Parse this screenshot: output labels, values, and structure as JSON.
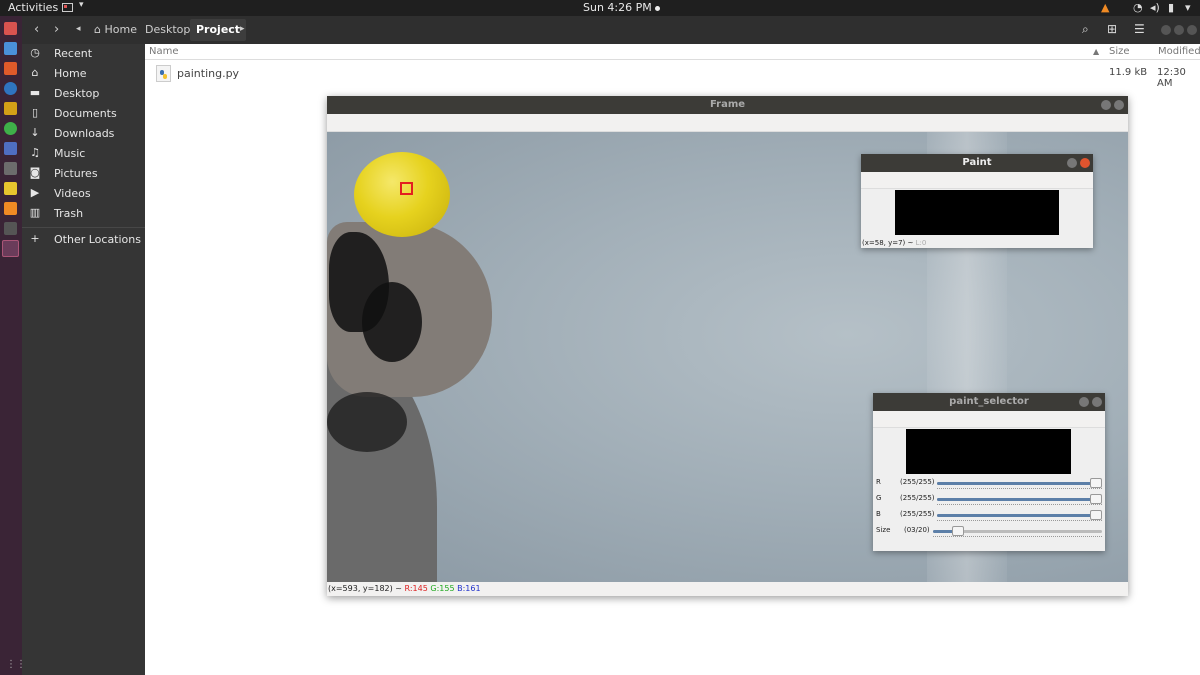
{
  "topbar": {
    "activities": "Activities",
    "clock": "Sun  4:26 PM"
  },
  "toolbar": {
    "crumbs": [
      "Home",
      "Desktop",
      "Project"
    ]
  },
  "sidebar": {
    "items": [
      {
        "label": "Recent",
        "icon": "clock-icon"
      },
      {
        "label": "Home",
        "icon": "home-icon"
      },
      {
        "label": "Desktop",
        "icon": "folder-icon"
      },
      {
        "label": "Documents",
        "icon": "document-icon"
      },
      {
        "label": "Downloads",
        "icon": "download-icon"
      },
      {
        "label": "Music",
        "icon": "music-icon"
      },
      {
        "label": "Pictures",
        "icon": "camera-icon"
      },
      {
        "label": "Videos",
        "icon": "video-icon"
      },
      {
        "label": "Trash",
        "icon": "trash-icon"
      },
      {
        "label": "Other Locations",
        "icon": "plus-icon"
      }
    ]
  },
  "filelist": {
    "columns": {
      "name": "Name",
      "size": "Size",
      "modified": "Modified"
    },
    "files": [
      {
        "name": "painting.py",
        "size": "11.9 kB",
        "modified": "12:30 AM"
      }
    ]
  },
  "frame": {
    "title": "Frame",
    "status_coords": "(x=593, y=182) ~",
    "status_r": "R:145",
    "status_g": "G:155",
    "status_b": "B:161"
  },
  "paint": {
    "title": "Paint",
    "status_coords": "(x=58, y=7) ~",
    "status_l": "L:0"
  },
  "selector": {
    "title": "paint_selector",
    "sliders": [
      {
        "name": "R",
        "value_text": "(255/255)",
        "fraction": 1.0
      },
      {
        "name": "G",
        "value_text": "(255/255)",
        "fraction": 1.0
      },
      {
        "name": "B",
        "value_text": "(255/255)",
        "fraction": 1.0
      },
      {
        "name": "Size",
        "value_text": "(03/20)",
        "fraction": 0.15
      }
    ]
  },
  "colors": {
    "dock": "#3a2436",
    "sidebar": "#353535",
    "titlebar": "#3c3b37",
    "slider_fill": "#5c7fa8",
    "marker": "#e32020"
  }
}
